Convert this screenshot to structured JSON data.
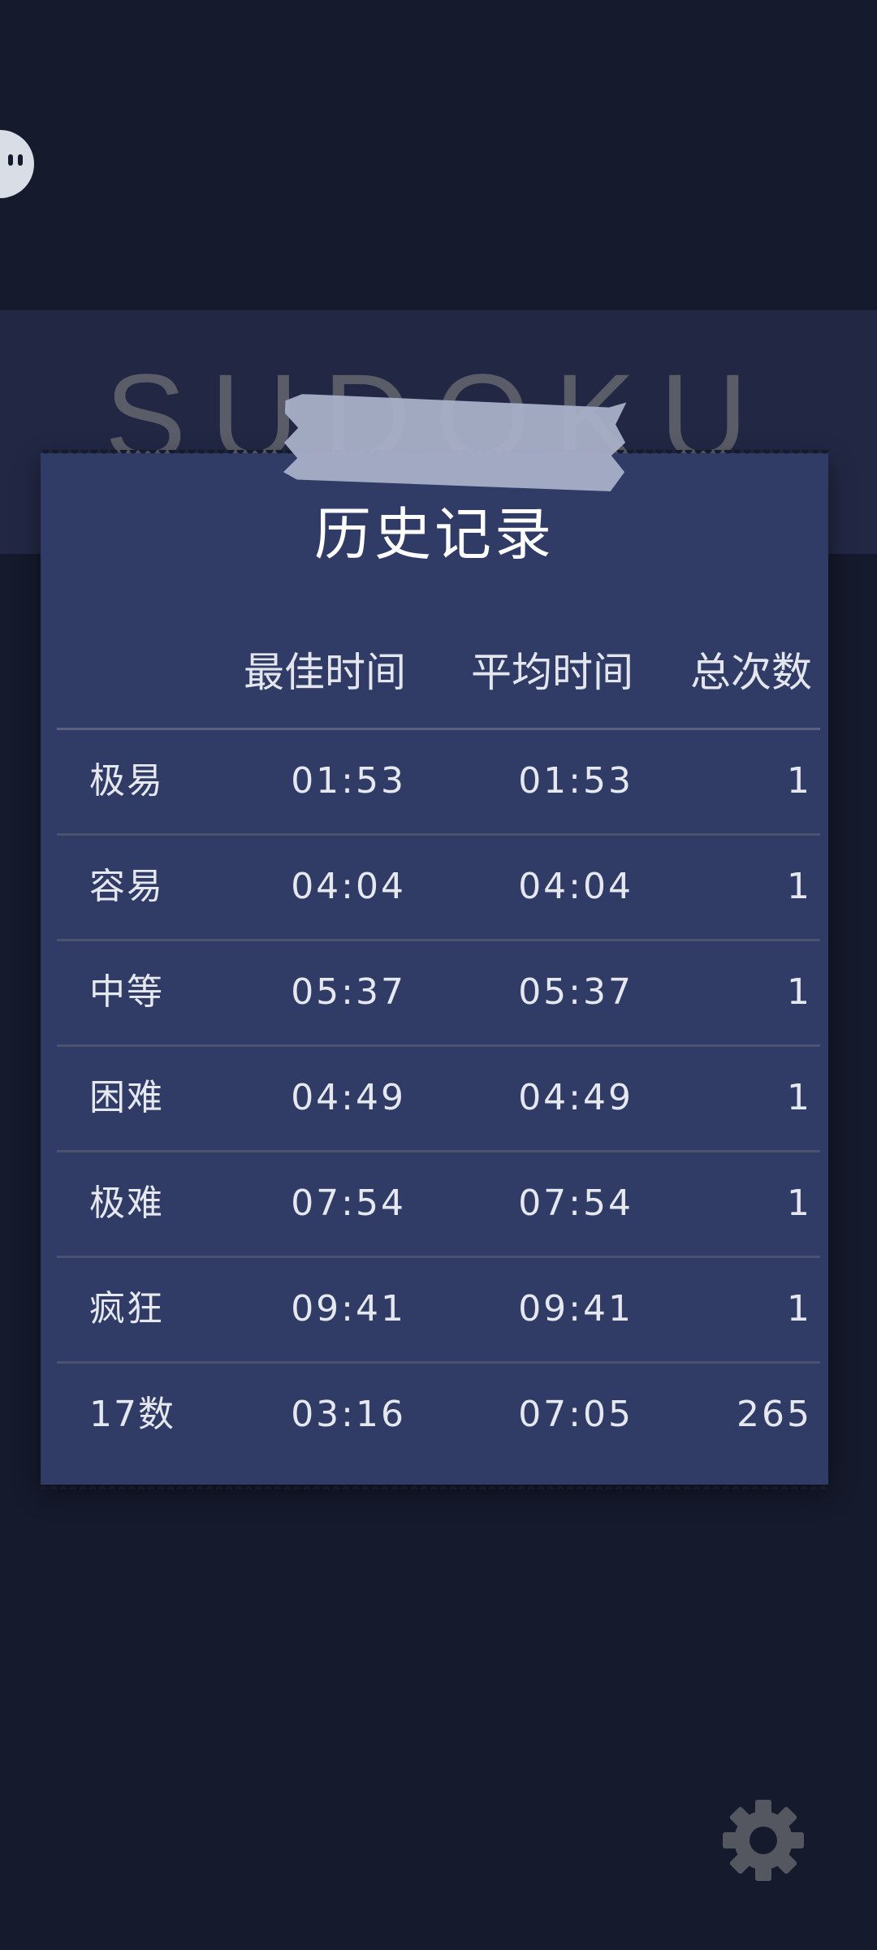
{
  "header": {
    "title": "SUDOKU"
  },
  "history": {
    "title": "历史记录",
    "columns": {
      "best": "最佳时间",
      "average": "平均时间",
      "total": "总次数"
    },
    "rows": [
      {
        "name": "极易",
        "best": "01:53",
        "average": "01:53",
        "total": "1"
      },
      {
        "name": "容易",
        "best": "04:04",
        "average": "04:04",
        "total": "1"
      },
      {
        "name": "中等",
        "best": "05:37",
        "average": "05:37",
        "total": "1"
      },
      {
        "name": "困难",
        "best": "04:49",
        "average": "04:49",
        "total": "1"
      },
      {
        "name": "极难",
        "best": "07:54",
        "average": "07:54",
        "total": "1"
      },
      {
        "name": "疯狂",
        "best": "09:41",
        "average": "09:41",
        "total": "1"
      },
      {
        "name": "17数",
        "best": "03:16",
        "average": "07:05",
        "total": "265"
      }
    ]
  },
  "icons": {
    "avatar": "avatar-icon",
    "settings": "gear-icon"
  },
  "colors": {
    "background": "#151a2c",
    "card": "#303c66",
    "banner": "#222844",
    "tape": "#a9b0c8"
  }
}
